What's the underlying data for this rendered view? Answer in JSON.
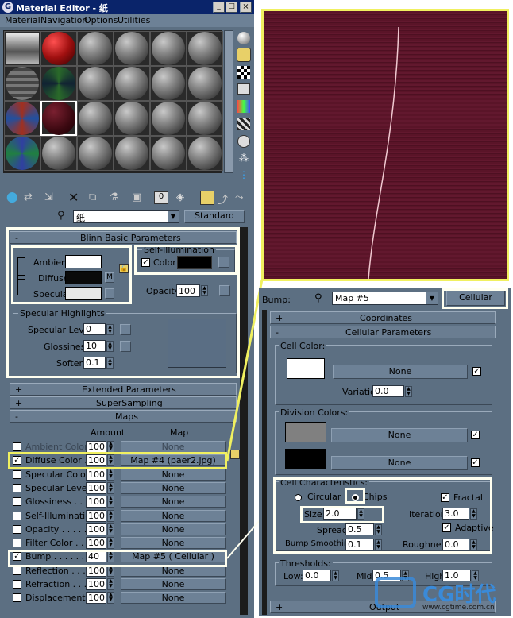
{
  "window": {
    "title": "Material Editor - 纸",
    "menu": [
      "Material",
      "Navigation",
      "Options",
      "Utilities"
    ],
    "min": "_",
    "max": "□",
    "close": "×"
  },
  "toolbar": {
    "material_name": "纸",
    "type_button": "Standard"
  },
  "blinn": {
    "header": "Blinn Basic Parameters",
    "ambient_label": "Ambient:",
    "diffuse_label": "Diffuse:",
    "specular_label": "Specular:",
    "lock_m": "M",
    "self_illum_title": "Self-Illumination",
    "color_label": "Color",
    "opacity_label": "Opacity:",
    "opacity_value": "100",
    "colors": {
      "ambient": "#ffffff",
      "diffuse": "#0a0a0a",
      "specular": "#e8e8e8",
      "self_illum": "#000000"
    }
  },
  "specular_highlights": {
    "title": "Specular Highlights",
    "level_label": "Specular Level:",
    "level_value": "0",
    "gloss_label": "Glossiness:",
    "gloss_value": "10",
    "soften_label": "Soften:",
    "soften_value": "0.1"
  },
  "rollouts": {
    "extended": "Extended Parameters",
    "supersampling": "SuperSampling",
    "maps": "Maps"
  },
  "maps": {
    "amount_header": "Amount",
    "map_header": "Map",
    "rows": [
      {
        "label": "Ambient Color",
        "checked": false,
        "amount": "100",
        "map": "None",
        "dim": true
      },
      {
        "label": "Diffuse Color . .",
        "checked": true,
        "amount": "100",
        "map": "Map #4 (paer2.jpg)",
        "dim": false
      },
      {
        "label": "Specular Color",
        "checked": false,
        "amount": "100",
        "map": "None",
        "dim": false
      },
      {
        "label": "Specular Level",
        "checked": false,
        "amount": "100",
        "map": "None",
        "dim": false
      },
      {
        "label": "Glossiness . . .",
        "checked": false,
        "amount": "100",
        "map": "None",
        "dim": false
      },
      {
        "label": "Self-Illumination",
        "checked": false,
        "amount": "100",
        "map": "None",
        "dim": false
      },
      {
        "label": "Opacity . . . . .",
        "checked": false,
        "amount": "100",
        "map": "None",
        "dim": false
      },
      {
        "label": "Filter Color . .",
        "checked": false,
        "amount": "100",
        "map": "None",
        "dim": false
      },
      {
        "label": "Bump . . . . . .",
        "checked": true,
        "amount": "40",
        "map": "Map #5  ( Cellular )",
        "dim": false
      },
      {
        "label": "Reflection . . .",
        "checked": false,
        "amount": "100",
        "map": "None",
        "dim": false
      },
      {
        "label": "Refraction . . .",
        "checked": false,
        "amount": "100",
        "map": "None",
        "dim": false
      },
      {
        "label": "Displacement . .",
        "checked": false,
        "amount": "100",
        "map": "None",
        "dim": false
      }
    ]
  },
  "bump_panel": {
    "bump_label": "Bump:",
    "map_name": "Map #5",
    "type_button": "Cellular",
    "coordinates": "Coordinates",
    "cellular_params": "Cellular Parameters",
    "cell_color_title": "Cell Color:",
    "none_label": "None",
    "variation_label": "Variation:",
    "variation_value": "0.0",
    "division_title": "Division Colors:",
    "cell_char_title": "Cell Characteristics:",
    "circular": "Circular",
    "chips": "Chips",
    "fractal": "Fractal",
    "size_label": "Size:",
    "size_value": "2.0",
    "iterations_label": "Iterations:",
    "iterations_value": "3.0",
    "adaptive": "Adaptive",
    "spread_label": "Spread:",
    "spread_value": "0.5",
    "bump_smooth_label": "Bump Smoothing:",
    "bump_smooth_value": "0.1",
    "roughness_label": "Roughness:",
    "roughness_value": "0.0",
    "thresholds_title": "Thresholds:",
    "low_label": "Low:",
    "low_value": "0.0",
    "mid_label": "Mid:",
    "mid_value": "0.5",
    "high_label": "High:",
    "high_value": "1.0",
    "output": "Output",
    "colors": {
      "cell": "#ffffff",
      "div1": "#808080",
      "div2": "#000000"
    }
  },
  "watermark": {
    "logo_text": "CG时代",
    "url": "www.cgtime.com.cn"
  },
  "texture_preview": {
    "color": "#5a1428"
  }
}
